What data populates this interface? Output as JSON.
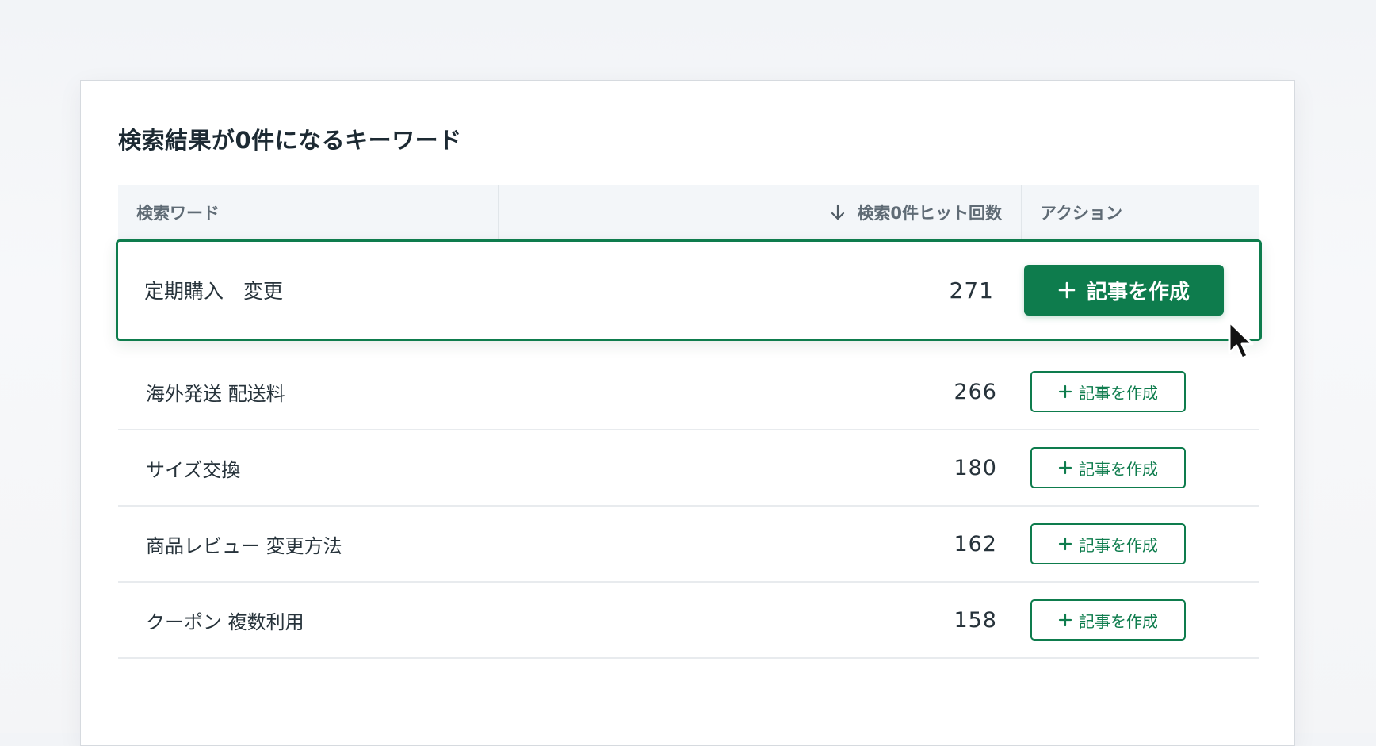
{
  "panel": {
    "title": "検索結果が0件になるキーワード"
  },
  "table": {
    "headers": {
      "keyword": "検索ワード",
      "count": "検索0件ヒット回数",
      "action": "アクション"
    },
    "sort_icon": "arrow-down-icon",
    "highlighted_row": {
      "keyword": "定期購入　変更",
      "count": "271",
      "action_label": "記事を作成"
    },
    "rows": [
      {
        "keyword": "海外発送  配送料",
        "count": "266",
        "action_label": "記事を作成"
      },
      {
        "keyword": "サイズ交換",
        "count": "180",
        "action_label": "記事を作成"
      },
      {
        "keyword": "商品レビュー 変更方法",
        "count": "162",
        "action_label": "記事を作成"
      },
      {
        "keyword": "クーポン 複数利用",
        "count": "158",
        "action_label": "記事を作成"
      }
    ]
  },
  "colors": {
    "accent": "#0e7c4d",
    "header_bg": "#f3f6f9",
    "text": "#27333b"
  },
  "icons": {
    "plus": "plus-icon",
    "cursor": "mouse-pointer-icon"
  }
}
